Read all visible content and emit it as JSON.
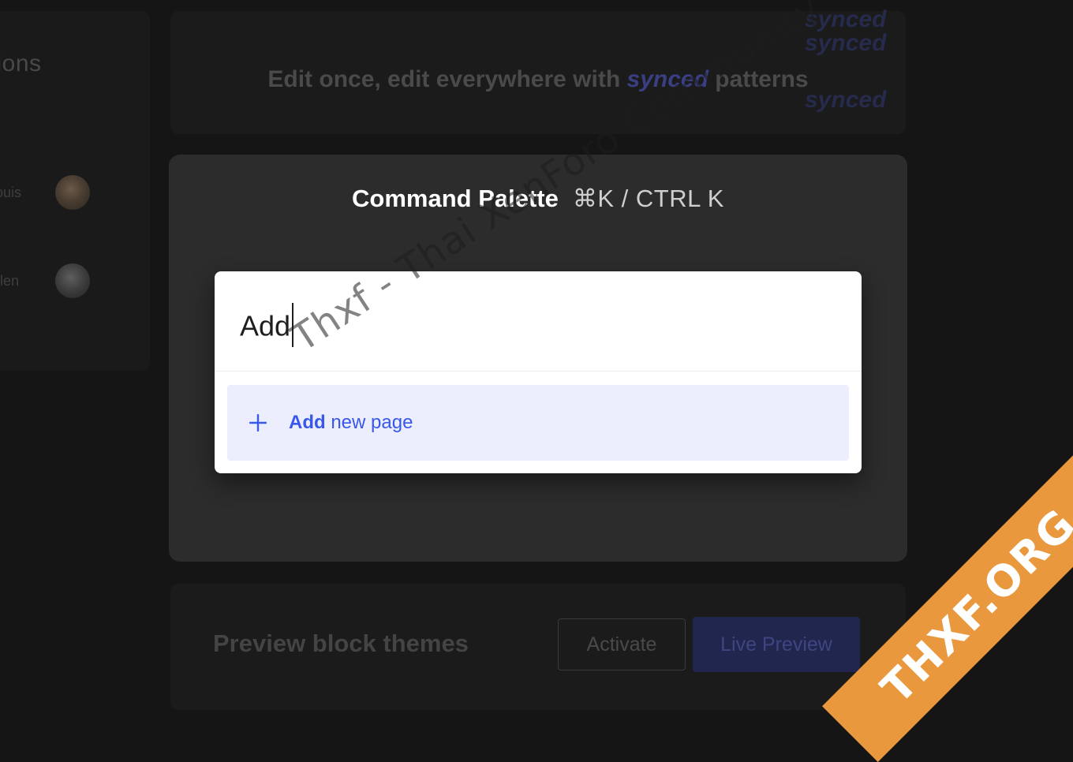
{
  "background": {
    "left_panel": {
      "title": "sions",
      "users": [
        {
          "name": "Louis"
        },
        {
          "name": "Ellen"
        }
      ]
    },
    "banner": {
      "text_before": "Edit once, edit everywhere with ",
      "accent_word": "synced",
      "text_after": " patterns"
    },
    "bottom_card": {
      "title": "Preview block themes",
      "activate_label": "Activate",
      "live_preview_label": "Live Preview"
    }
  },
  "command_palette": {
    "title": "Command Palette",
    "shortcut": "⌘K / CTRL K",
    "search_value": "Add",
    "results": [
      {
        "icon": "plus-icon",
        "bold": "Add",
        "rest": " new page"
      }
    ]
  },
  "watermark": "Thxf - Thai XenForo Community",
  "ribbon": "THXF.ORG",
  "colors": {
    "accent": "#3858e9",
    "result_highlight": "#eceefd",
    "ribbon": "#e9983d"
  }
}
